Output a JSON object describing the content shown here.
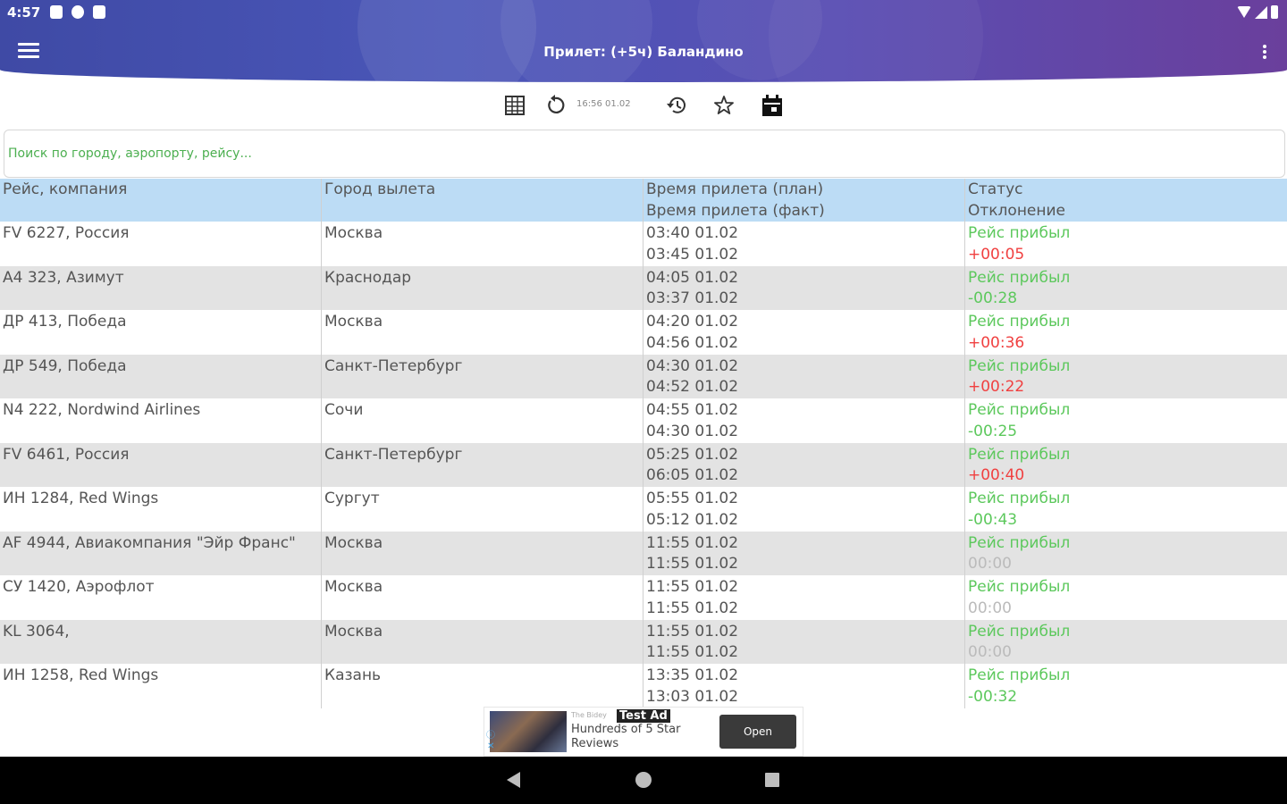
{
  "status_bar": {
    "time": "4:57"
  },
  "app_bar": {
    "title": "Прилет: (+5ч) Баландино"
  },
  "toolbar": {
    "last_update": "16:56 01.02"
  },
  "search": {
    "placeholder": "Поиск по городу, аэропорту, рейсу..."
  },
  "table": {
    "headers": [
      {
        "line1": "Рейс, компания",
        "line2": ""
      },
      {
        "line1": "Город вылета",
        "line2": ""
      },
      {
        "line1": "Время прилета (план)",
        "line2": "Время прилета (факт)"
      },
      {
        "line1": "Статус",
        "line2": "Отклонение"
      }
    ],
    "rows": [
      {
        "flight": "FV 6227, Россия",
        "city": "Москва",
        "plan": "03:40 01.02",
        "fact": "03:45 01.02",
        "status": "Рейс прибыл",
        "deviation": "+00:05"
      },
      {
        "flight": "А4 323, Азимут",
        "city": "Краснодар",
        "plan": "04:05 01.02",
        "fact": "03:37 01.02",
        "status": "Рейс прибыл",
        "deviation": "-00:28"
      },
      {
        "flight": "ДР 413, Победа",
        "city": "Москва",
        "plan": "04:20 01.02",
        "fact": "04:56 01.02",
        "status": "Рейс прибыл",
        "deviation": "+00:36"
      },
      {
        "flight": "ДР 549, Победа",
        "city": "Санкт-Петербург",
        "plan": "04:30 01.02",
        "fact": "04:52 01.02",
        "status": "Рейс прибыл",
        "deviation": "+00:22"
      },
      {
        "flight": "N4 222, Nordwind Airlines",
        "city": "Сочи",
        "plan": "04:55 01.02",
        "fact": "04:30 01.02",
        "status": "Рейс прибыл",
        "deviation": "-00:25"
      },
      {
        "flight": "FV 6461, Россия",
        "city": "Санкт-Петербург",
        "plan": "05:25 01.02",
        "fact": "06:05 01.02",
        "status": "Рейс прибыл",
        "deviation": "+00:40"
      },
      {
        "flight": "ИН 1284, Red Wings",
        "city": "Сургут",
        "plan": "05:55 01.02",
        "fact": "05:12 01.02",
        "status": "Рейс прибыл",
        "deviation": "-00:43"
      },
      {
        "flight": "AF 4944, Авиакомпания \"Эйр Франс\"",
        "city": "Москва",
        "plan": "11:55 01.02",
        "fact": "11:55 01.02",
        "status": "Рейс прибыл",
        "deviation": "00:00"
      },
      {
        "flight": "СУ 1420, Аэрофлот",
        "city": "Москва",
        "plan": "11:55 01.02",
        "fact": "11:55 01.02",
        "status": "Рейс прибыл",
        "deviation": "00:00"
      },
      {
        "flight": "KL 3064,",
        "city": "Москва",
        "plan": "11:55 01.02",
        "fact": "11:55 01.02",
        "status": "Рейс прибыл",
        "deviation": "00:00"
      },
      {
        "flight": "ИН 1258, Red Wings",
        "city": "Казань",
        "plan": "13:35 01.02",
        "fact": "13:03 01.02",
        "status": "Рейс прибыл",
        "deviation": "-00:32"
      }
    ]
  },
  "ad": {
    "label": "Test Ad",
    "brand": "The Bidey",
    "text": "Hundreds of 5 Star Reviews",
    "button": "Open"
  },
  "colors": {
    "header_bg": "#bcdcf5",
    "alt_row_bg": "#e3e3e3",
    "status_green": "#5cc85c",
    "late_red": "#f04040",
    "zero_gray": "#bbbbbb",
    "appbar_start": "#3f4aa5",
    "appbar_end": "#6a3f9c"
  },
  "icons": {
    "menu": "hamburger-icon",
    "more": "more-vert-icon",
    "grid": "table-grid-icon",
    "refresh": "refresh-icon",
    "history": "history-icon",
    "favorite": "star-outline-icon",
    "calendar": "calendar-icon"
  }
}
